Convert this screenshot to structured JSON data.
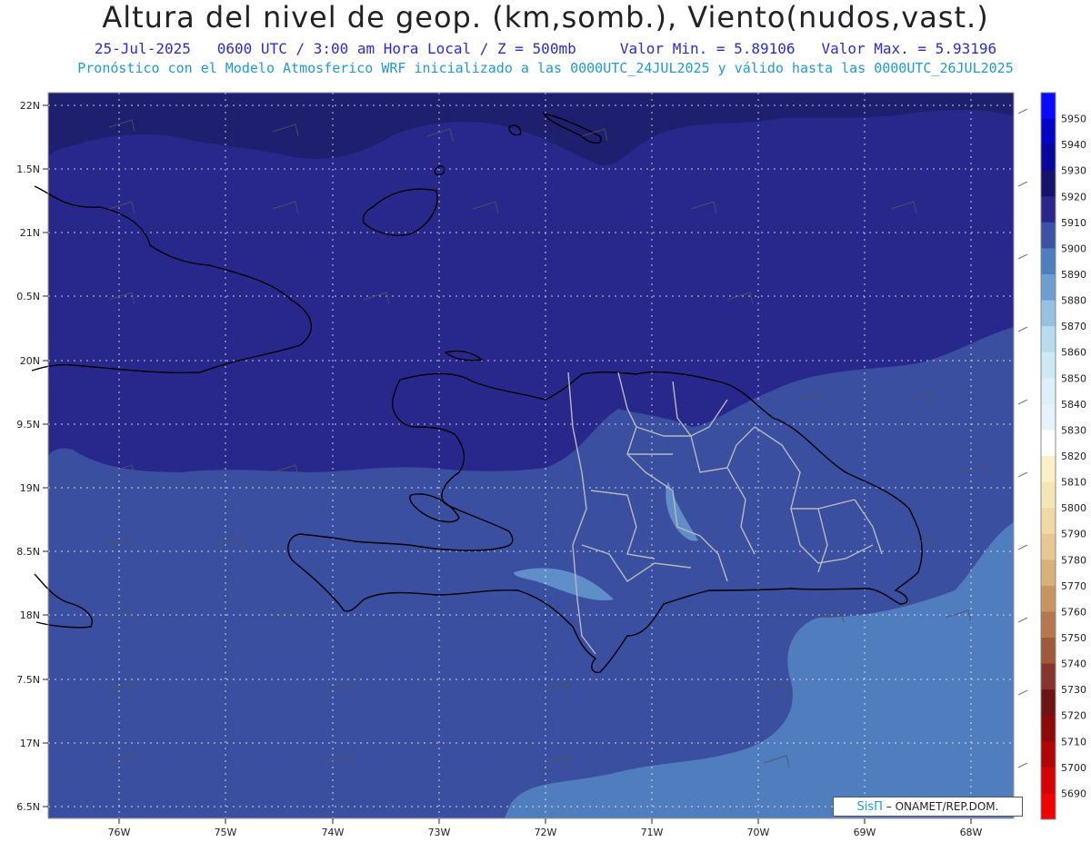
{
  "header": {
    "title": "Altura del nivel de geop. (km,somb.), Viento(nudos,vast.)",
    "date": "25-Jul-2025",
    "time_info": "0600 UTC / 3:00 am Hora Local / Z = 500mb",
    "min_value": "Valor Min. = 5.89106",
    "max_value": "Valor Max. = 5.93196",
    "forecast_info": "Pronóstico con el Modelo Atmosferico WRF inicializado a las 0000UTC_24JUL2025 y válido hasta las  0000UTC_26JUL2025"
  },
  "axes": {
    "lat_labels": [
      "22N",
      "1.5N",
      "21N",
      "0.5N",
      "20N",
      "9.5N",
      "19N",
      "8.5N",
      "18N",
      "7.5N",
      "17N",
      "6.5N"
    ],
    "lon_labels": [
      "76W",
      "75W",
      "74W",
      "73W",
      "72W",
      "71W",
      "70W",
      "69W",
      "68W"
    ]
  },
  "colorbar": {
    "labels": [
      "5950",
      "5940",
      "5930",
      "5920",
      "5910",
      "5900",
      "5890",
      "5880",
      "5870",
      "5860",
      "5850",
      "5840",
      "5830",
      "5820",
      "5810",
      "5800",
      "5790",
      "5780",
      "5770",
      "5760",
      "5750",
      "5740",
      "5730",
      "5720",
      "5710",
      "5700",
      "5690"
    ],
    "colors": [
      "#0a0aff",
      "#0505c8",
      "#08089a",
      "#14146e",
      "#28288c",
      "#3c52a6",
      "#4e7ebe",
      "#6e9ed0",
      "#96c2e2",
      "#b6dcee",
      "#cceaf4",
      "#dcf0f8",
      "#e4f4fa",
      "#ffffff",
      "#fbf0c8",
      "#f5e6b6",
      "#efdaa6",
      "#e6c890",
      "#d8b07a",
      "#c89462",
      "#b4784c",
      "#9e5a3a",
      "#86342c",
      "#6e1414",
      "#8c0a0a",
      "#b00606",
      "#d40404",
      "#ee0202"
    ]
  },
  "credit": {
    "sis": "SisΠ",
    "org": " – ONAMET/REP.DOM."
  },
  "colors": {
    "level_5920": "#1e1f6e",
    "level_5910": "#28288c",
    "level_5900": "#3a4f9f",
    "level_5890": "#4f7dbd",
    "level_5880": "#6e9ed0"
  }
}
